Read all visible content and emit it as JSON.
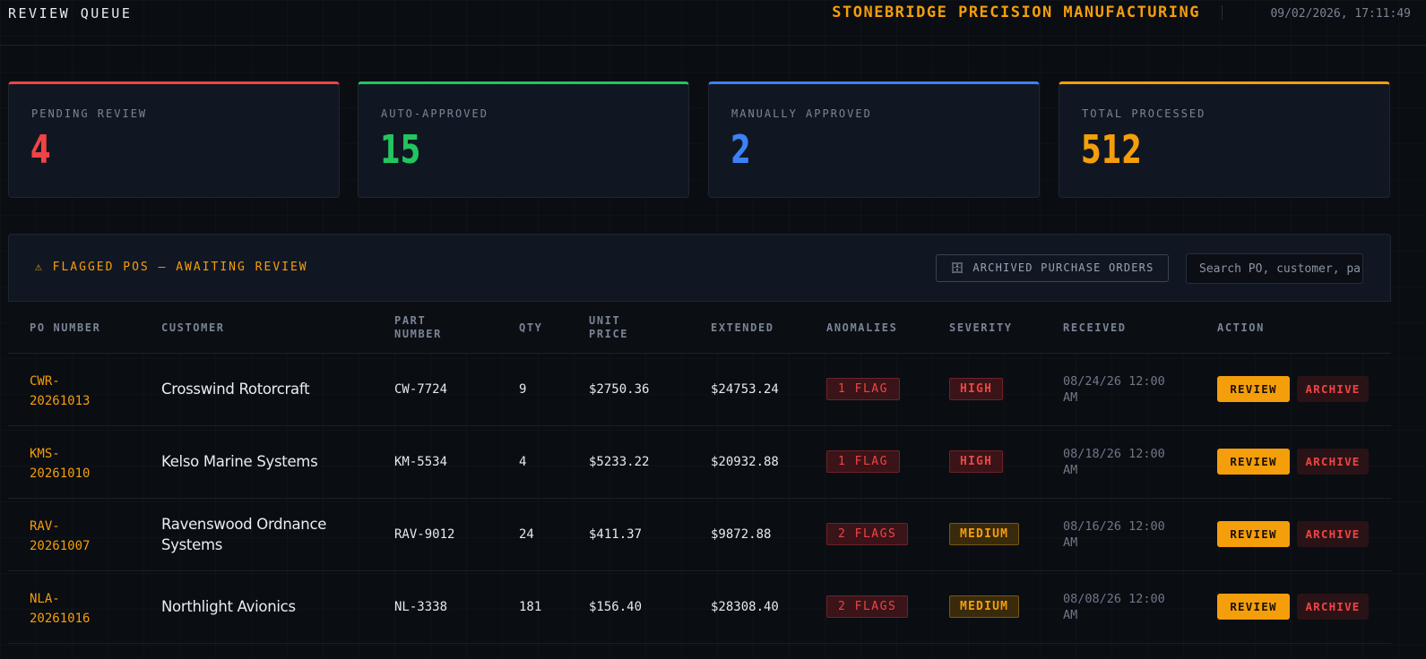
{
  "header": {
    "app_title": "REVIEW QUEUE",
    "company": "STONEBRIDGE PRECISION MANUFACTURING",
    "timestamp": "09/02/2026, 17:11:49"
  },
  "stats": [
    {
      "label": "PENDING REVIEW",
      "value": "4",
      "color": "#ef4444"
    },
    {
      "label": "AUTO-APPROVED",
      "value": "15",
      "color": "#22c55e"
    },
    {
      "label": "MANUALLY APPROVED",
      "value": "2",
      "color": "#3b82f6"
    },
    {
      "label": "TOTAL PROCESSED",
      "value": "512",
      "color": "#f59e0b"
    }
  ],
  "panel": {
    "title": "⚠ FLAGGED POS — AWAITING REVIEW",
    "archived_button": "🗄 ARCHIVED PURCHASE ORDERS",
    "search_placeholder": "Search PO, customer, part..."
  },
  "table": {
    "columns": [
      "PO NUMBER",
      "CUSTOMER",
      "PART NUMBER",
      "QTY",
      "UNIT PRICE",
      "EXTENDED",
      "ANOMALIES",
      "SEVERITY",
      "RECEIVED",
      "ACTION"
    ],
    "rows": [
      {
        "po_a": "CWR-",
        "po_b": "20261013",
        "customer": "Crosswind Rotorcraft",
        "part": "CW-7724",
        "qty": "9",
        "unit_price": "$2750.36",
        "extended": "$24753.24",
        "anomalies": "1 FLAG",
        "severity": "HIGH",
        "received_a": "08/24/26 12:00",
        "received_b": "AM",
        "review": "REVIEW",
        "archive": "ARCHIVE"
      },
      {
        "po_a": "KMS-",
        "po_b": "20261010",
        "customer": "Kelso Marine Systems",
        "part": "KM-5534",
        "qty": "4",
        "unit_price": "$5233.22",
        "extended": "$20932.88",
        "anomalies": "1 FLAG",
        "severity": "HIGH",
        "received_a": "08/18/26 12:00",
        "received_b": "AM",
        "review": "REVIEW",
        "archive": "ARCHIVE"
      },
      {
        "po_a": "RAV-",
        "po_b": "20261007",
        "customer": "Ravenswood Ordnance Systems",
        "part": "RAV-9012",
        "qty": "24",
        "unit_price": "$411.37",
        "extended": "$9872.88",
        "anomalies": "2 FLAGS",
        "severity": "MEDIUM",
        "received_a": "08/16/26 12:00",
        "received_b": "AM",
        "review": "REVIEW",
        "archive": "ARCHIVE"
      },
      {
        "po_a": "NLA-",
        "po_b": "20261016",
        "customer": "Northlight Avionics",
        "part": "NL-3338",
        "qty": "181",
        "unit_price": "$156.40",
        "extended": "$28308.40",
        "anomalies": "2 FLAGS",
        "severity": "MEDIUM",
        "received_a": "08/08/26 12:00",
        "received_b": "AM",
        "review": "REVIEW",
        "archive": "ARCHIVE"
      }
    ]
  }
}
